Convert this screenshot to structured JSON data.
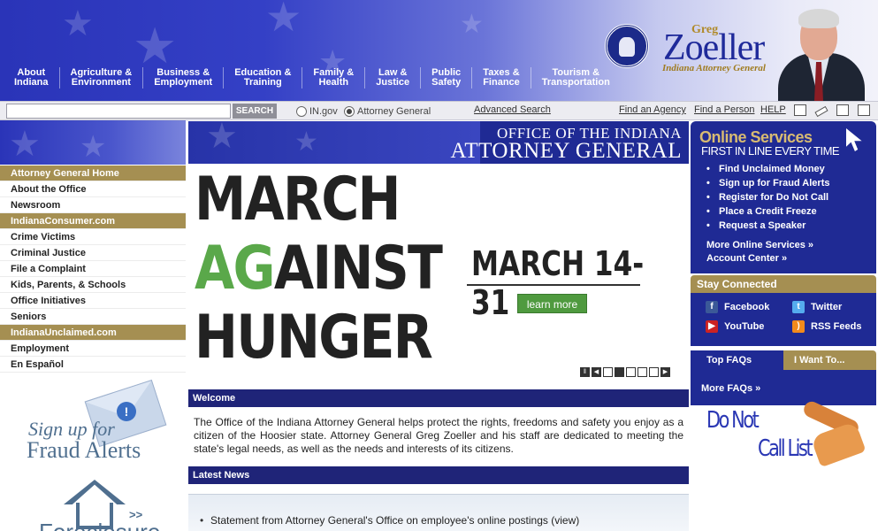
{
  "header": {
    "nav": [
      {
        "line1": "About",
        "line2": "Indiana"
      },
      {
        "line1": "Agriculture &",
        "line2": "Environment"
      },
      {
        "line1": "Business &",
        "line2": "Employment"
      },
      {
        "line1": "Education &",
        "line2": "Training"
      },
      {
        "line1": "Family &",
        "line2": "Health"
      },
      {
        "line1": "Law &",
        "line2": "Justice"
      },
      {
        "line1": "Public",
        "line2": "Safety"
      },
      {
        "line1": "Taxes &",
        "line2": "Finance"
      },
      {
        "line1": "Tourism &",
        "line2": "Transportation"
      }
    ],
    "ag_first_name": "Greg",
    "ag_last_name": "Zoeller",
    "ag_title": "Indiana Attorney General"
  },
  "searchbar": {
    "input_value": "",
    "button_label": "SEARCH",
    "radio_ingov": "IN.gov",
    "radio_ag": "Attorney General",
    "advanced_search": "Advanced Search",
    "find_agency": "Find an Agency",
    "find_person": "Find a Person",
    "help": "HELP"
  },
  "left_nav": [
    {
      "label": "Attorney General Home",
      "header": true
    },
    {
      "label": "About the Office",
      "header": false
    },
    {
      "label": "Newsroom",
      "header": false
    },
    {
      "label": "IndianaConsumer.com",
      "header": true
    },
    {
      "label": "Crime Victims",
      "header": false
    },
    {
      "label": "Criminal Justice",
      "header": false
    },
    {
      "label": "File a Complaint",
      "header": false
    },
    {
      "label": "Kids, Parents, & Schools",
      "header": false
    },
    {
      "label": "Office Initiatives",
      "header": false
    },
    {
      "label": "Seniors",
      "header": false
    },
    {
      "label": "IndianaUnclaimed.com",
      "header": true
    },
    {
      "label": "Employment",
      "header": false
    },
    {
      "label": "En Español",
      "header": false
    }
  ],
  "promos": {
    "fraud_line1": "Sign up for",
    "fraud_line2": "Fraud Alerts",
    "foreclosure_arrows": ">>",
    "foreclosure_text": "Foreclosure"
  },
  "center": {
    "office_line1": "OFFICE OF THE INDIANA",
    "office_line2": "ATTORNEY GENERAL",
    "hero_line1": "MARCH",
    "hero_ag": "AG",
    "hero_line2_rest": "AINST",
    "hero_line3": "HUNGER",
    "hero_dates": "MARCH 14-31",
    "learn_more": "learn more",
    "welcome_header": "Welcome",
    "welcome_text": "The Office of the Indiana Attorney General helps protect the rights, freedoms and safety you enjoy as a citizen of the Hoosier state. Attorney General Greg Zoeller and his staff are dedicated to meeting the state's legal needs, as well as the needs and interests of its citizens.",
    "news_header": "Latest News",
    "news_items": [
      "Statement from Attorney General's Office on employee's online postings (view)"
    ]
  },
  "right": {
    "online_title": "Online Services",
    "online_subtitle": "FIRST IN LINE EVERY TIME",
    "online_items": [
      "Find Unclaimed Money",
      "Sign up for Fraud Alerts",
      "Register for Do Not Call",
      "Place a Credit Freeze",
      "Request a Speaker"
    ],
    "more_online": "More Online Services »",
    "account_center": "Account Center »",
    "stay_connected": "Stay Connected",
    "facebook": "Facebook",
    "twitter": "Twitter",
    "youtube": "YouTube",
    "rss": "RSS Feeds",
    "tab_top_faqs": "Top FAQs",
    "tab_want_to": "I Want To...",
    "more_faqs": "More FAQs »",
    "dnc_line1": "Do Not",
    "dnc_line2": "Call List"
  },
  "colors": {
    "navy": "#1f2a94",
    "gold": "#a58f52",
    "green": "#5aa84a",
    "hunger_green": "#4f9a3f"
  }
}
